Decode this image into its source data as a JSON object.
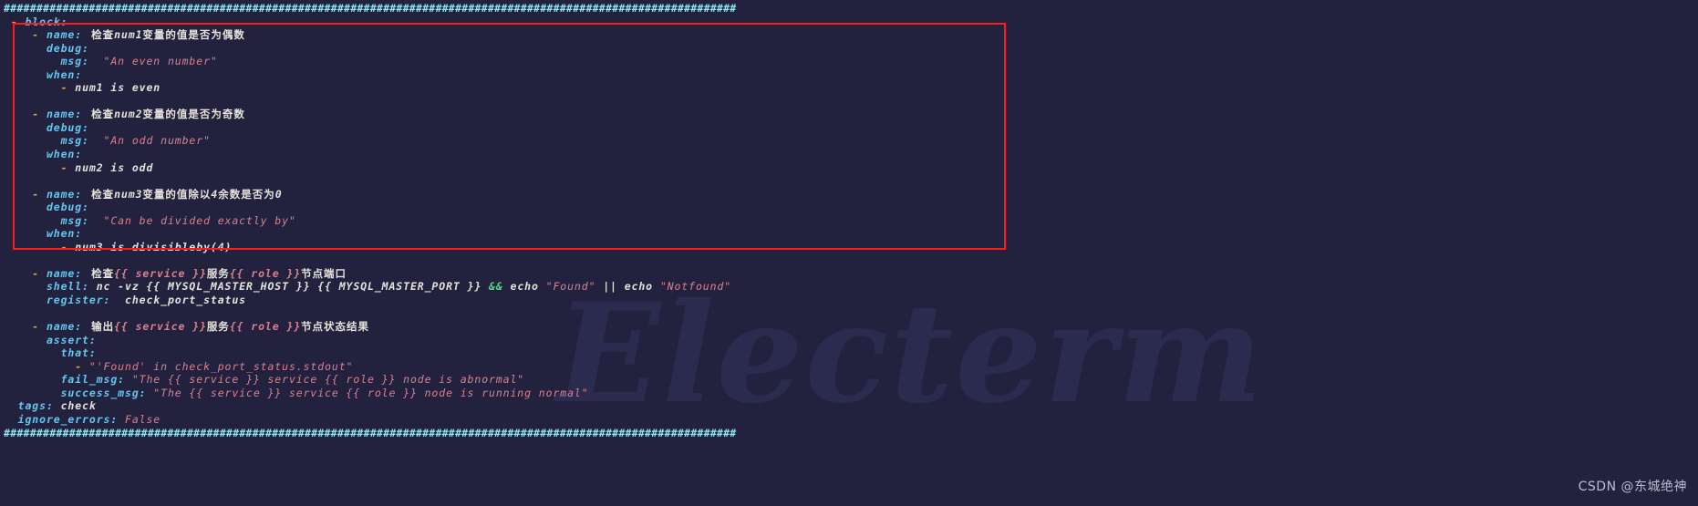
{
  "terminal": {
    "app_watermark": "Electerm",
    "background_color": "#22223f",
    "highlight_color": "#ff1a1a",
    "credit_watermark": "CSDN @东城绝神"
  },
  "lines": [
    {
      "id": "rule-top",
      "kind": "rule",
      "text": "################################################################################################################"
    },
    {
      "id": "block",
      "kind": "code",
      "segments": [
        {
          "cls": "dash",
          "t": " - "
        },
        {
          "cls": "key",
          "t": "block:"
        }
      ]
    },
    {
      "id": "t1-name",
      "kind": "code",
      "segments": [
        {
          "cls": "dash",
          "t": "    - "
        },
        {
          "cls": "key",
          "t": "name:"
        },
        {
          "cls": "cn",
          "t": "  检查"
        },
        {
          "cls": "plain",
          "t": "num1"
        },
        {
          "cls": "cn",
          "t": "变量的值是否为偶数"
        }
      ]
    },
    {
      "id": "t1-debug",
      "kind": "code",
      "segments": [
        {
          "cls": "key",
          "t": "      debug:"
        }
      ]
    },
    {
      "id": "t1-msg",
      "kind": "code",
      "segments": [
        {
          "cls": "key",
          "t": "        msg:"
        },
        {
          "cls": "str",
          "t": "  \"An even number\""
        }
      ]
    },
    {
      "id": "t1-when",
      "kind": "code",
      "segments": [
        {
          "cls": "key",
          "t": "      when:"
        }
      ]
    },
    {
      "id": "t1-cond",
      "kind": "code",
      "segments": [
        {
          "cls": "dash",
          "t": "        - "
        },
        {
          "cls": "plain",
          "t": "num1 is even"
        }
      ]
    },
    {
      "id": "gap1",
      "kind": "blank",
      "text": " "
    },
    {
      "id": "t2-name",
      "kind": "code",
      "segments": [
        {
          "cls": "dash",
          "t": "    - "
        },
        {
          "cls": "key",
          "t": "name:"
        },
        {
          "cls": "cn",
          "t": "  检查"
        },
        {
          "cls": "plain",
          "t": "num2"
        },
        {
          "cls": "cn",
          "t": "变量的值是否为奇数"
        }
      ]
    },
    {
      "id": "t2-debug",
      "kind": "code",
      "segments": [
        {
          "cls": "key",
          "t": "      debug:"
        }
      ]
    },
    {
      "id": "t2-msg",
      "kind": "code",
      "segments": [
        {
          "cls": "key",
          "t": "        msg:"
        },
        {
          "cls": "str",
          "t": "  \"An odd number\""
        }
      ]
    },
    {
      "id": "t2-when",
      "kind": "code",
      "segments": [
        {
          "cls": "key",
          "t": "      when:"
        }
      ]
    },
    {
      "id": "t2-cond",
      "kind": "code",
      "segments": [
        {
          "cls": "dash",
          "t": "        - "
        },
        {
          "cls": "plain",
          "t": "num2 is odd"
        }
      ]
    },
    {
      "id": "gap2",
      "kind": "blank",
      "text": " "
    },
    {
      "id": "t3-name",
      "kind": "code",
      "segments": [
        {
          "cls": "dash",
          "t": "    - "
        },
        {
          "cls": "key",
          "t": "name:"
        },
        {
          "cls": "cn",
          "t": "  检查"
        },
        {
          "cls": "plain",
          "t": "num3"
        },
        {
          "cls": "cn",
          "t": "变量的值除以"
        },
        {
          "cls": "plain",
          "t": "4"
        },
        {
          "cls": "cn",
          "t": "余数是否为"
        },
        {
          "cls": "plain",
          "t": "0"
        }
      ]
    },
    {
      "id": "t3-debug",
      "kind": "code",
      "segments": [
        {
          "cls": "key",
          "t": "      debug:"
        }
      ]
    },
    {
      "id": "t3-msg",
      "kind": "code",
      "segments": [
        {
          "cls": "key",
          "t": "        msg:"
        },
        {
          "cls": "str",
          "t": "  \"Can be divided exactly by\""
        }
      ]
    },
    {
      "id": "t3-when",
      "kind": "code",
      "segments": [
        {
          "cls": "key",
          "t": "      when:"
        }
      ]
    },
    {
      "id": "t3-cond",
      "kind": "code",
      "segments": [
        {
          "cls": "dash",
          "t": "        - "
        },
        {
          "cls": "plain",
          "t": "num3 is divisibleby(4)"
        }
      ]
    },
    {
      "id": "gap3",
      "kind": "blank",
      "text": " "
    },
    {
      "id": "t4-name",
      "kind": "code",
      "segments": [
        {
          "cls": "dash",
          "t": "    - "
        },
        {
          "cls": "key",
          "t": "name:"
        },
        {
          "cls": "cn",
          "t": "  检查"
        },
        {
          "cls": "jinja",
          "t": "{{ service }}"
        },
        {
          "cls": "cn",
          "t": "服务"
        },
        {
          "cls": "jinja",
          "t": "{{ role }}"
        },
        {
          "cls": "cn",
          "t": "节点端口"
        }
      ]
    },
    {
      "id": "t4-shell",
      "kind": "code",
      "segments": [
        {
          "cls": "key",
          "t": "      shell:"
        },
        {
          "cls": "plain",
          "t": " nc -vz "
        },
        {
          "cls": "plain",
          "t": "{{ MYSQL_MASTER_HOST }} {{ MYSQL_MASTER_PORT }} "
        },
        {
          "cls": "op",
          "t": "&& "
        },
        {
          "cls": "plain",
          "t": "echo "
        },
        {
          "cls": "str",
          "t": "\"Found\""
        },
        {
          "cls": "pipe",
          "t": " || "
        },
        {
          "cls": "plain",
          "t": "echo "
        },
        {
          "cls": "str",
          "t": "\"Notfound\""
        }
      ]
    },
    {
      "id": "t4-register",
      "kind": "code",
      "segments": [
        {
          "cls": "key",
          "t": "      register:"
        },
        {
          "cls": "plain",
          "t": "  check_port_status"
        }
      ]
    },
    {
      "id": "gap4",
      "kind": "blank",
      "text": " "
    },
    {
      "id": "t5-name",
      "kind": "code",
      "segments": [
        {
          "cls": "dash",
          "t": "    - "
        },
        {
          "cls": "key",
          "t": "name:"
        },
        {
          "cls": "cn",
          "t": "  输出"
        },
        {
          "cls": "jinja",
          "t": "{{ service }}"
        },
        {
          "cls": "cn",
          "t": "服务"
        },
        {
          "cls": "jinja",
          "t": "{{ role }}"
        },
        {
          "cls": "cn",
          "t": "节点状态结果"
        }
      ]
    },
    {
      "id": "t5-assert",
      "kind": "code",
      "segments": [
        {
          "cls": "key",
          "t": "      assert:"
        }
      ]
    },
    {
      "id": "t5-that",
      "kind": "code",
      "segments": [
        {
          "cls": "key",
          "t": "        that:"
        }
      ]
    },
    {
      "id": "t5-that-item",
      "kind": "code",
      "segments": [
        {
          "cls": "dash",
          "t": "          - "
        },
        {
          "cls": "str",
          "t": "\"'Found' in check_port_status.stdout\""
        }
      ]
    },
    {
      "id": "t5-failmsg",
      "kind": "code",
      "segments": [
        {
          "cls": "key",
          "t": "        fail_msg:"
        },
        {
          "cls": "str",
          "t": " \"The {{ service }} service {{ role }} node is abnormal\""
        }
      ]
    },
    {
      "id": "t5-successmsg",
      "kind": "code",
      "segments": [
        {
          "cls": "key",
          "t": "        success_msg:"
        },
        {
          "cls": "str",
          "t": " \"The {{ service }} service {{ role }} node is running normal\""
        }
      ]
    },
    {
      "id": "tags",
      "kind": "code",
      "segments": [
        {
          "cls": "key",
          "t": "  tags:"
        },
        {
          "cls": "plain",
          "t": " check"
        }
      ]
    },
    {
      "id": "ignore-errors",
      "kind": "code",
      "segments": [
        {
          "cls": "key",
          "t": "  ignore_errors:"
        },
        {
          "cls": "bool",
          "t": " False"
        }
      ]
    },
    {
      "id": "rule-bottom",
      "kind": "rule",
      "text": "################################################################################################################"
    }
  ]
}
